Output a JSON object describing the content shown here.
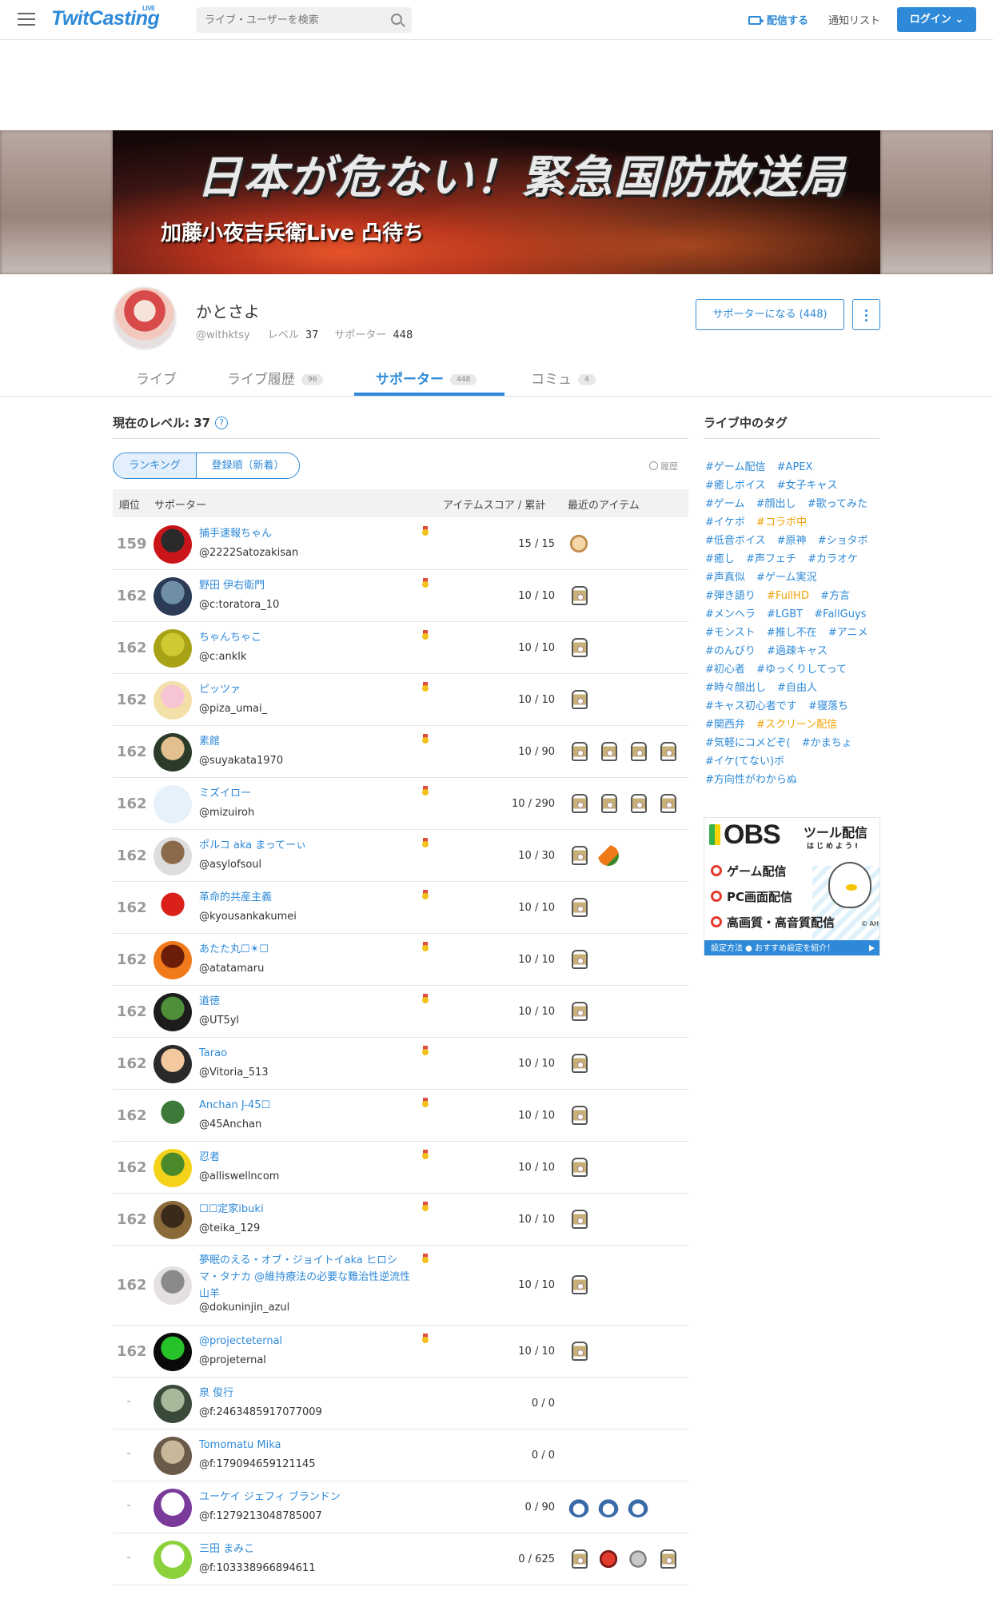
{
  "header": {
    "logo": "TwitCasting",
    "logo_sup": "LIVE",
    "search_placeholder": "ライブ・ユーザーを検索",
    "broadcast_label": "配信する",
    "notifications_label": "通知リスト",
    "login_label": "ログイン"
  },
  "banner": {
    "title": "日本が危ない！緊急国防放送局",
    "subtitle": "加藤小夜吉兵衛Live 凸待ち"
  },
  "profile": {
    "name": "かとさよ",
    "handle": "@withktsy",
    "level_label": "レベル",
    "level": "37",
    "supporter_label": "サポーター",
    "supporter_count": "448",
    "become_supporter_button": "サポーターになる (448)"
  },
  "tabs": [
    {
      "label": "ライブ",
      "badge": ""
    },
    {
      "label": "ライブ履歴",
      "badge": "96"
    },
    {
      "label": "サポーター",
      "badge": "448"
    },
    {
      "label": "コミュ",
      "badge": "4"
    }
  ],
  "supporters_panel": {
    "current_level_text": "現在のレベル: 37",
    "help_icon": "?",
    "toggle_ranking": "ランキング",
    "toggle_newest": "登録順（新着）",
    "history_link": "履歴",
    "columns": {
      "rank": "順位",
      "supporter": "サポーター",
      "score": "アイテムスコア / 累計",
      "recent": "最近のアイテム"
    },
    "rows": [
      {
        "rank": "159",
        "name": "捕手速報ちゃん",
        "id": "@2222Satozakisan",
        "score": "15 / 15",
        "medal": true,
        "items": [
          "hand"
        ],
        "avatar": [
          "#c9141a",
          "#2a2a2a"
        ]
      },
      {
        "rank": "162",
        "name": "野田 伊右衛門",
        "id": "@c:toratora_10",
        "score": "10 / 10",
        "medal": true,
        "items": [
          "tea"
        ],
        "avatar": [
          "#2b3a55",
          "#6f8fa8"
        ]
      },
      {
        "rank": "162",
        "name": "ちゃんちゃこ",
        "id": "@c:anklk",
        "score": "10 / 10",
        "medal": true,
        "items": [
          "tea"
        ],
        "avatar": [
          "#a7a315",
          "#cfc932"
        ]
      },
      {
        "rank": "162",
        "name": "ピッツァ",
        "id": "@piza_umai_",
        "score": "10 / 10",
        "medal": true,
        "items": [
          "tea"
        ],
        "avatar": [
          "#f3e0a8",
          "#f7c4d3"
        ]
      },
      {
        "rank": "162",
        "name": "素館",
        "id": "@suyakata1970",
        "score": "10 / 90",
        "medal": true,
        "items": [
          "tea",
          "tea",
          "tea",
          "tea"
        ],
        "avatar": [
          "#2a3b2a",
          "#e4c090"
        ]
      },
      {
        "rank": "162",
        "name": "ミズイロー",
        "id": "@mizuiroh",
        "score": "10 / 290",
        "medal": true,
        "items": [
          "tea",
          "tea",
          "tea",
          "tea"
        ],
        "avatar": [
          "#e6f1fb",
          "#e6f1fb"
        ]
      },
      {
        "rank": "162",
        "name": "ポルコ aka まってーぃ",
        "id": "@asylofsoul",
        "score": "10 / 30",
        "medal": true,
        "items": [
          "tea",
          "carrot"
        ],
        "avatar": [
          "#ddd",
          "#8a6a4a"
        ]
      },
      {
        "rank": "162",
        "name": "革命的共産主義",
        "id": "@kyousankakumei",
        "score": "10 / 10",
        "medal": true,
        "items": [
          "tea"
        ],
        "avatar": [
          "#ffffff",
          "#d9211a"
        ]
      },
      {
        "rank": "162",
        "name": "あたた丸☐☀☐",
        "id": "@atatamaru",
        "score": "10 / 10",
        "medal": true,
        "items": [
          "tea"
        ],
        "avatar": [
          "#f07a1a",
          "#6b1d0a"
        ]
      },
      {
        "rank": "162",
        "name": "道徳",
        "id": "@UT5yl",
        "score": "10 / 10",
        "medal": true,
        "items": [
          "tea"
        ],
        "avatar": [
          "#1c1c1c",
          "#4f8f3a"
        ]
      },
      {
        "rank": "162",
        "name": "Tarao",
        "id": "@Vitoria_513",
        "score": "10 / 10",
        "medal": true,
        "items": [
          "tea"
        ],
        "avatar": [
          "#2a2a2a",
          "#f4c9a0"
        ]
      },
      {
        "rank": "162",
        "name": "Anchan J-45☐",
        "id": "@45Anchan",
        "score": "10 / 10",
        "medal": true,
        "items": [
          "tea"
        ],
        "avatar": [
          "#fff",
          "#3d7a3a"
        ]
      },
      {
        "rank": "162",
        "name": "忍者",
        "id": "@alliswellncom",
        "score": "10 / 10",
        "medal": true,
        "items": [
          "tea"
        ],
        "avatar": [
          "#f5d21a",
          "#4a8a2a"
        ]
      },
      {
        "rank": "162",
        "name": "☐☐定家ibuki",
        "id": "@teika_129",
        "score": "10 / 10",
        "medal": true,
        "items": [
          "tea"
        ],
        "avatar": [
          "#8b6a3a",
          "#3a2a1a"
        ]
      },
      {
        "rank": "162",
        "name": "夢眠のえる・オブ・ジョイトイaka ヒロシマ・タナカ @維持療法の必要な難治性逆流性山羊",
        "id": "@dokuninjin_azul",
        "score": "10 / 10",
        "medal": true,
        "items": [
          "tea"
        ],
        "avatar": [
          "#e4e0e0",
          "#8a8a8a"
        ]
      },
      {
        "rank": "162",
        "name": "@projecteternal",
        "id": "@projeternal",
        "score": "10 / 10",
        "medal": true,
        "items": [
          "tea"
        ],
        "avatar": [
          "#0a0a0a",
          "#27c22a"
        ]
      },
      {
        "rank": "-",
        "name": "泉 俊行",
        "id": "@f:2463485917077009",
        "score": "0 / 0",
        "medal": false,
        "items": [],
        "avatar": [
          "#3a4a3a",
          "#a8b89a"
        ]
      },
      {
        "rank": "-",
        "name": "Tomomatu Mika",
        "id": "@f:179094659121145",
        "score": "0 / 0",
        "medal": false,
        "items": [],
        "avatar": [
          "#6a5a4a",
          "#c8b89a"
        ]
      },
      {
        "rank": "-",
        "name": "ユーケイ ジェフィ ブランドン",
        "id": "@f:1279213048785007",
        "score": "0 / 90",
        "medal": false,
        "items": [
          "penguin",
          "penguin",
          "penguin"
        ],
        "avatar": [
          "#7a3a9a",
          "#ffffff"
        ]
      },
      {
        "rank": "-",
        "name": "三田 まみこ",
        "id": "@f:103338966894611",
        "score": "0 / 625",
        "medal": false,
        "items": [
          "tea",
          "candy",
          "coin",
          "tea"
        ],
        "avatar": [
          "#8ad13a",
          "#ffffff"
        ]
      }
    ]
  },
  "sidebar": {
    "heading": "ライブ中のタグ",
    "tags": [
      {
        "t": "#ゲーム配信",
        "hot": false
      },
      {
        "t": "#APEX",
        "hot": false
      },
      {
        "t": "#癒しボイス",
        "hot": false
      },
      {
        "t": "#女子キャス",
        "hot": false
      },
      {
        "t": "#ゲーム",
        "hot": false
      },
      {
        "t": "#顔出し",
        "hot": false
      },
      {
        "t": "#歌ってみた",
        "hot": false
      },
      {
        "t": "#イケボ",
        "hot": false
      },
      {
        "t": "#コラボ中",
        "hot": true
      },
      {
        "t": "#低音ボイス",
        "hot": false
      },
      {
        "t": "#原神",
        "hot": false
      },
      {
        "t": "#ショタボ",
        "hot": false
      },
      {
        "t": "#癒し",
        "hot": false
      },
      {
        "t": "#声フェチ",
        "hot": false
      },
      {
        "t": "#カラオケ",
        "hot": false
      },
      {
        "t": "#声真似",
        "hot": false
      },
      {
        "t": "#ゲーム実況",
        "hot": false
      },
      {
        "t": "#弾き語り",
        "hot": false
      },
      {
        "t": "#FullHD",
        "hot": true
      },
      {
        "t": "#方言",
        "hot": false
      },
      {
        "t": "#メンヘラ",
        "hot": false
      },
      {
        "t": "#LGBT",
        "hot": false
      },
      {
        "t": "#FallGuys",
        "hot": false
      },
      {
        "t": "#モンスト",
        "hot": false
      },
      {
        "t": "#推し不在",
        "hot": false
      },
      {
        "t": "#アニメ",
        "hot": false
      },
      {
        "t": "#のんびり",
        "hot": false
      },
      {
        "t": "#過疎キャス",
        "hot": false
      },
      {
        "t": "#初心者",
        "hot": false
      },
      {
        "t": "#ゆっくりしてって",
        "hot": false
      },
      {
        "t": "#時々顔出し",
        "hot": false
      },
      {
        "t": "#自由人",
        "hot": false
      },
      {
        "t": "#キャス初心者です",
        "hot": false
      },
      {
        "t": "#寝落ち",
        "hot": false
      },
      {
        "t": "#関西弁",
        "hot": false
      },
      {
        "t": "#スクリーン配信",
        "hot": true
      },
      {
        "t": "#気軽にコメどぞ(",
        "hot": false
      },
      {
        "t": "#かまちょ",
        "hot": false
      },
      {
        "t": "#イケ(てない)ボ",
        "hot": false
      },
      {
        "t": "#方向性がわからぬ",
        "hot": false
      }
    ],
    "ad": {
      "brand": "OBS",
      "title": "ツール配信",
      "subtitle": "はじめよう!",
      "features": [
        "ゲーム配信",
        "PC画面配信",
        "高画質・高音質配信"
      ],
      "credit": "© AH",
      "footer": "設定方法 ● おすすめ設定を紹介！"
    }
  }
}
